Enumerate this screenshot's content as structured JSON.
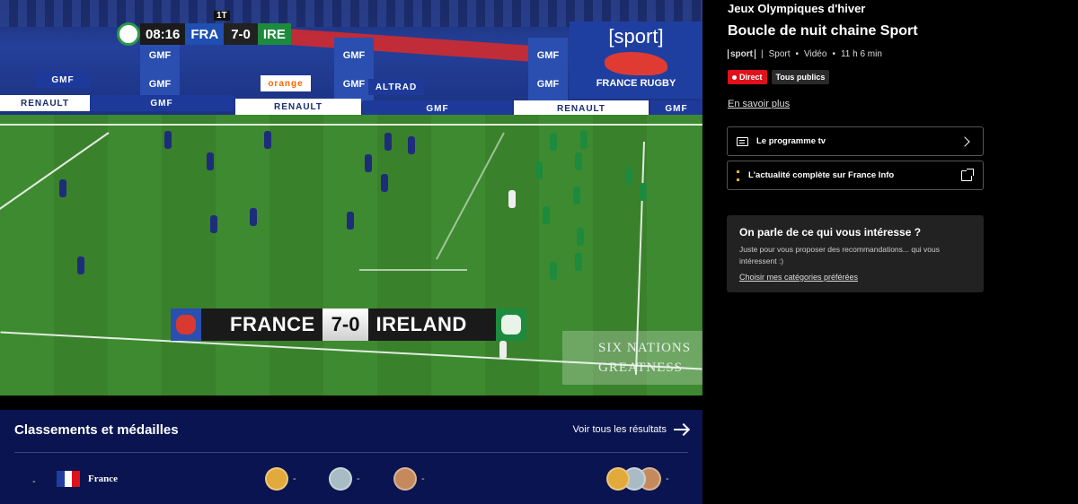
{
  "video": {
    "score_bug": {
      "period": "1T",
      "clock": "08:16",
      "home": "FRA",
      "score": "7-0",
      "away": "IRE"
    },
    "big_score": {
      "home": "FRANCE",
      "score": "7-0",
      "away": "IRELAND"
    },
    "ads": {
      "gmf": "GMF",
      "renault": "RENAULT",
      "orange": "orange",
      "altrad": "ALTRAD",
      "sport_logo": "[sport]",
      "france_rugby": "FRANCE RUGBY",
      "six_nations_1": "SIX NATIONS",
      "six_nations_2": "GREATNESS"
    }
  },
  "side": {
    "category": "Jeux Olympiques d'hiver",
    "title": "Boucle de nuit chaine Sport",
    "meta": {
      "channel_logo": "sport",
      "genre": "Sport",
      "type": "Vidéo",
      "time": "11 h 6 min",
      "sep": "•"
    },
    "badges": {
      "live": "Direct",
      "audience": "Tous publics"
    },
    "more_link": "En savoir plus",
    "program_button": "Le programme tv",
    "news_button": "L'actualité complète sur France Info",
    "card": {
      "title": "On parle de ce qui vous intéresse ?",
      "text": "Juste pour vous proposer des recommandations... qui vous intéressent :)",
      "link": "Choisir mes catégories préférées"
    }
  },
  "medals": {
    "title": "Classements et médailles",
    "see_all": "Voir tous les résultats",
    "row": {
      "rank": "-",
      "country": "France",
      "gold": "-",
      "silver": "-",
      "bronze": "-",
      "total": "-"
    }
  },
  "colors": {
    "live_red": "#e0111b",
    "medal_bg": "#0a1450",
    "gold": "#e2a93b",
    "silver": "#a9bcc6",
    "bronze": "#c48a5e",
    "france_info_yellow": "#f3b21a"
  }
}
